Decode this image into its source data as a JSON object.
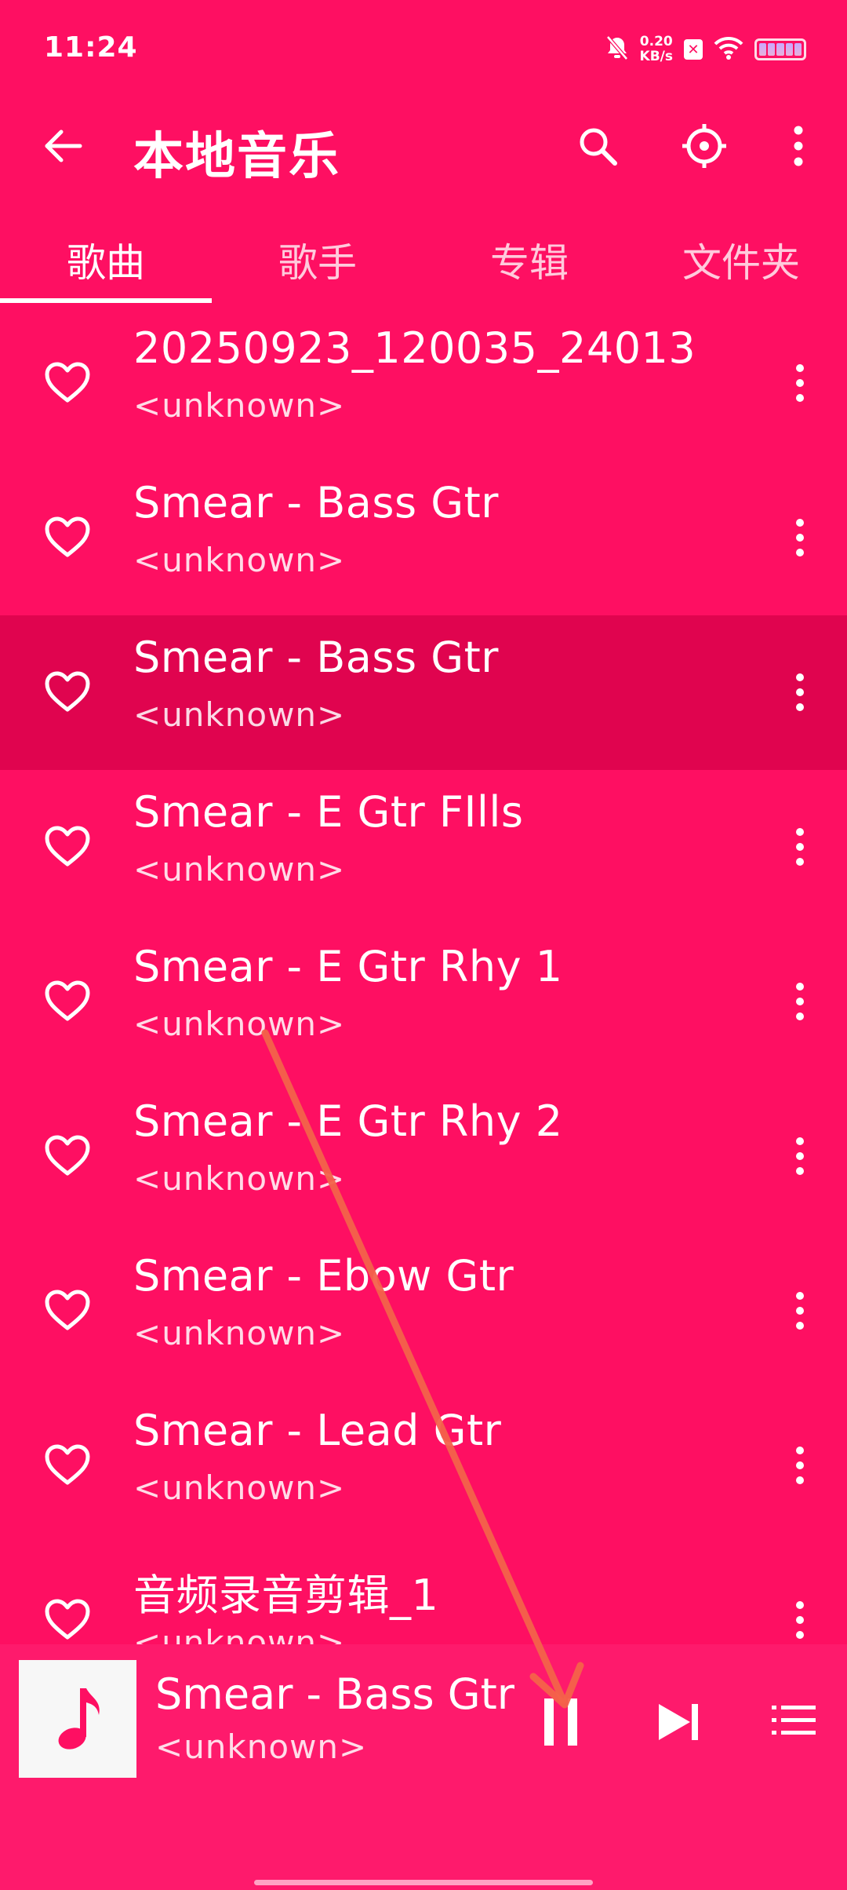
{
  "status_bar": {
    "time": "11:24",
    "net_speed_value": "0.20",
    "net_speed_unit": "KB/s",
    "icons": [
      "mute-bell-icon",
      "sim-x-icon",
      "wifi-icon",
      "battery-icon"
    ]
  },
  "app_bar": {
    "title": "本地音乐",
    "icons": [
      "back-arrow-icon",
      "search-icon",
      "locate-icon",
      "more-vertical-icon"
    ]
  },
  "tabs": [
    {
      "label": "歌曲",
      "active": true
    },
    {
      "label": "歌手",
      "active": false
    },
    {
      "label": "专辑",
      "active": false
    },
    {
      "label": "文件夹",
      "active": false
    }
  ],
  "songs": [
    {
      "title": "20250923_120035_24013",
      "artist": "<unknown>",
      "highlighted": false
    },
    {
      "title": "Smear - Bass Gtr",
      "artist": "<unknown>",
      "highlighted": false
    },
    {
      "title": "Smear - Bass Gtr",
      "artist": "<unknown>",
      "highlighted": true
    },
    {
      "title": "Smear - E Gtr FIlls",
      "artist": "<unknown>",
      "highlighted": false
    },
    {
      "title": "Smear - E Gtr Rhy 1",
      "artist": "<unknown>",
      "highlighted": false
    },
    {
      "title": "Smear - E Gtr Rhy 2",
      "artist": "<unknown>",
      "highlighted": false
    },
    {
      "title": "Smear - Ebow Gtr",
      "artist": "<unknown>",
      "highlighted": false
    },
    {
      "title": "Smear - Lead Gtr",
      "artist": "<unknown>",
      "highlighted": false
    },
    {
      "title": "音频录音剪辑_1",
      "artist": "<unknown>",
      "highlighted": false
    }
  ],
  "mini_player": {
    "title": "Smear - Bass Gtr",
    "artist": "<unknown>",
    "state": "playing",
    "icons": [
      "music-note-icon",
      "pause-icon",
      "skip-next-icon",
      "queue-list-icon"
    ]
  },
  "colors": {
    "background": "#fe0f62",
    "highlight_row": "#e0044f",
    "mini_player": "#fe1a6c",
    "album_art_note": "#fe0f62",
    "annotation_arrow": "#f4634a"
  }
}
